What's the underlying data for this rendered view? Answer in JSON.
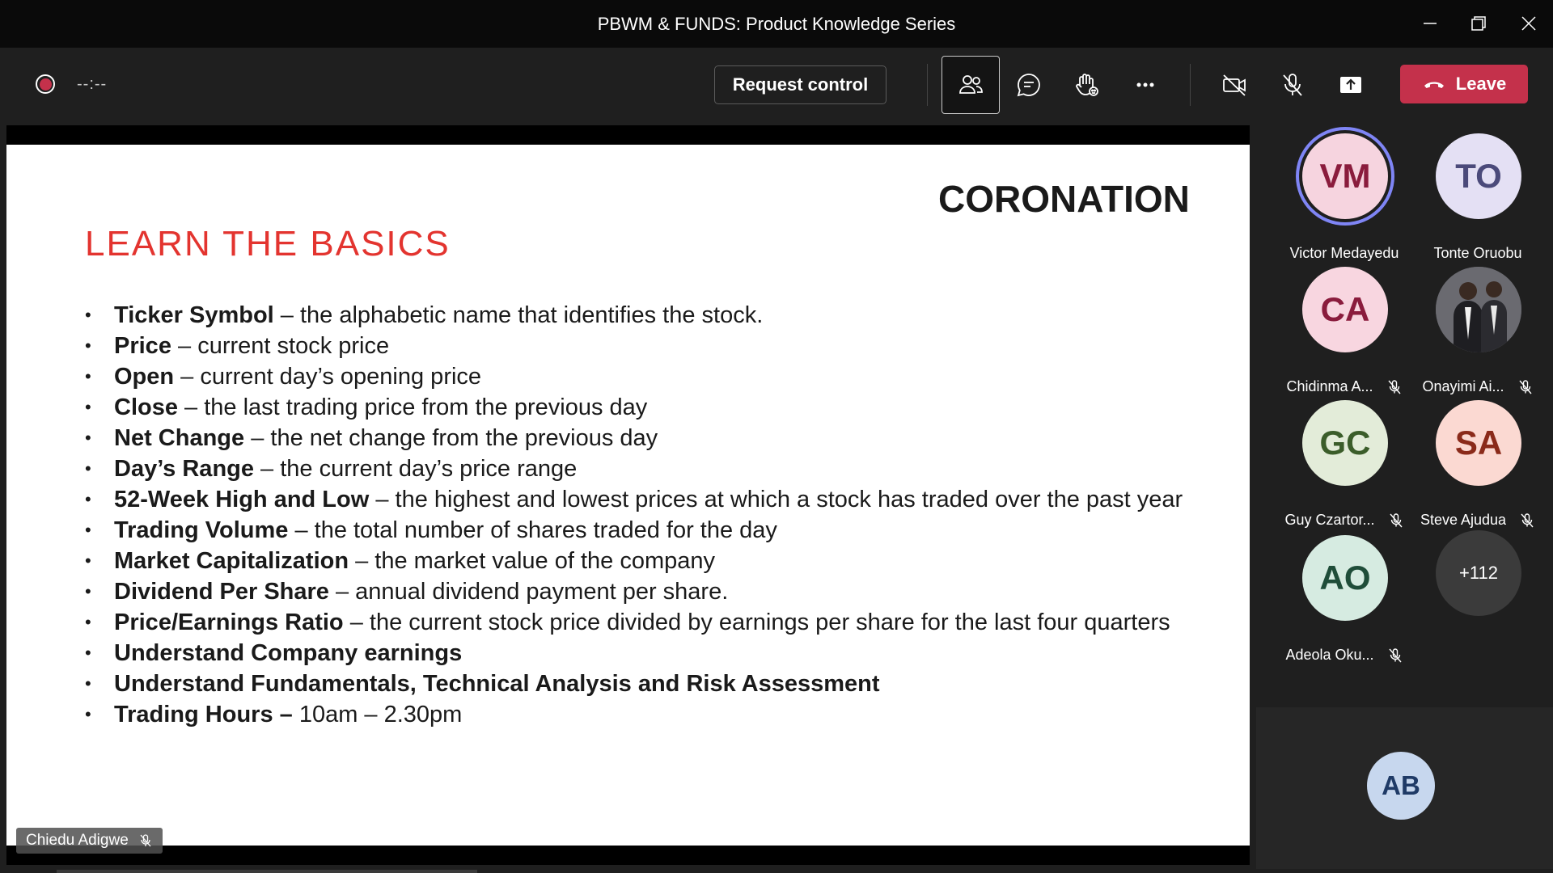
{
  "window": {
    "title": "PBWM & FUNDS: Product Knowledge Series"
  },
  "toolbar": {
    "timer": "--:--",
    "request_control_label": "Request control",
    "leave_label": "Leave",
    "icons": [
      "people-icon",
      "chat-icon",
      "raise-hand-icon",
      "more-options-icon",
      "camera-off-icon",
      "mic-off-icon",
      "share-screen-icon"
    ],
    "colors": {
      "leave": "#c4314b",
      "record": "#c4314b"
    }
  },
  "slide": {
    "brand": "CORONATION",
    "title": "LEARN THE BASICS",
    "bullets": [
      {
        "term": "Ticker Symbol",
        "desc": " – the alphabetic name that identifies the stock."
      },
      {
        "term": "Price",
        "desc": " – current stock price"
      },
      {
        "term": "Open",
        "desc": " – current day’s opening price"
      },
      {
        "term": "Close",
        "desc": " – the last trading price from the previous day"
      },
      {
        "term": "Net Change",
        "desc": " – the net change from the previous day"
      },
      {
        "term": "Day’s Range",
        "desc": " – the current day’s price range"
      },
      {
        "term": "52-Week High and Low",
        "desc": " – the highest and lowest prices at which a stock has traded over the past year"
      },
      {
        "term": "Trading Volume",
        "desc": " – the total number of shares traded for the day"
      },
      {
        "term": "Market Capitalization",
        "desc": " – the market value of the company"
      },
      {
        "term": "Dividend Per Share",
        "desc": " – annual dividend payment per share."
      },
      {
        "term": "Price/Earnings Ratio",
        "desc": " – the current stock price divided by earnings per share for the last four quarters"
      },
      {
        "term": "Understand Company earnings",
        "desc": ""
      },
      {
        "term": "Understand Fundamentals, Technical Analysis and Risk Assessment",
        "desc": ""
      },
      {
        "term": "Trading Hours –",
        "desc": " 10am – 2.30pm"
      }
    ],
    "title_color": "#e3342f"
  },
  "presenter": {
    "name": "Chiedu Adigwe"
  },
  "participants": [
    {
      "initials": "VM",
      "name": "Victor Medayedu",
      "bg": "#f6d4df",
      "fg": "#8a1c3d",
      "speaking": true,
      "muted": false
    },
    {
      "initials": "TO",
      "name": "Tonte Oruobu",
      "bg": "#e4e0f4",
      "fg": "#4b4a7a",
      "speaking": false,
      "muted": false
    },
    {
      "initials": "CA",
      "name": "Chidinma A...",
      "bg": "#f8d6e0",
      "fg": "#8a1c3d",
      "speaking": false,
      "muted": true
    },
    {
      "initials": "",
      "name": "Onayimi Ai...",
      "bg": "#5d5d63",
      "fg": "#ffffff",
      "speaking": false,
      "muted": true,
      "photo": true
    },
    {
      "initials": "GC",
      "name": "Guy Czartor...",
      "bg": "#e3ecd9",
      "fg": "#3b5d2a",
      "speaking": false,
      "muted": true
    },
    {
      "initials": "SA",
      "name": "Steve Ajudua",
      "bg": "#fbd9d2",
      "fg": "#8a2a1a",
      "speaking": false,
      "muted": true
    },
    {
      "initials": "AO",
      "name": "Adeola Oku...",
      "bg": "#d6ebe1",
      "fg": "#1f4d39",
      "speaking": false,
      "muted": true
    }
  ],
  "overflow": {
    "label": "+112"
  },
  "self": {
    "initials": "AB"
  }
}
